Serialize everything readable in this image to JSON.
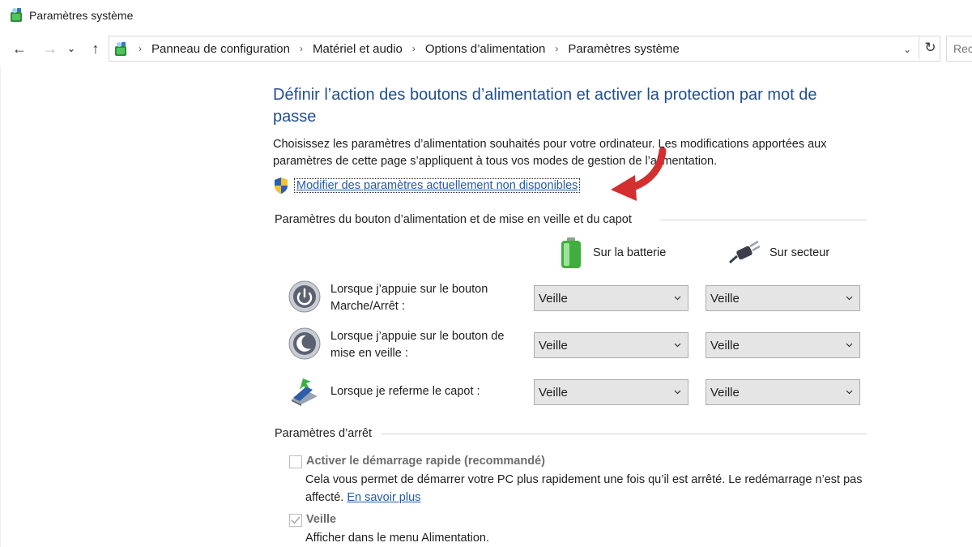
{
  "window": {
    "title": "Paramètres système"
  },
  "navigation": {
    "back_glyph": "←",
    "forward_glyph": "→",
    "recent_glyph": "⌄",
    "up_glyph": "↑",
    "breadcrumbs": [
      "Panneau de configuration",
      "Matériel et audio",
      "Options d’alimentation",
      "Paramètres système"
    ],
    "separator": "›",
    "dropdown_glyph": "⌄",
    "refresh_glyph": "↻",
    "search_placeholder": "Rec"
  },
  "main": {
    "heading": "Définir l’action des boutons d’alimentation et activer la protection par mot de passe",
    "description": "Choisissez les paramètres d’alimentation souhaités pour votre ordinateur. Les modifications apportées aux paramètres de cette page s’appliquent à tous vos modes de gestion de l’alimentation.",
    "modify_link": "Modifier des paramètres actuellement non disponibles"
  },
  "buttons_section": {
    "title": "Paramètres du bouton d’alimentation et de mise en veille et du capot",
    "columns": {
      "battery": "Sur la batterie",
      "plugged": "Sur secteur"
    },
    "rows": [
      {
        "icon": "power-button-icon",
        "label": "Lorsque j’appuie sur le bouton Marche/Arrêt :",
        "battery": "Veille",
        "plugged": "Veille"
      },
      {
        "icon": "sleep-button-icon",
        "label": "Lorsque j’appuie sur le bouton de mise en veille :",
        "battery": "Veille",
        "plugged": "Veille"
      },
      {
        "icon": "laptop-lid-icon",
        "label": "Lorsque je referme le capot :",
        "battery": "Veille",
        "plugged": "Veille"
      }
    ]
  },
  "shutdown_section": {
    "title": "Paramètres d’arrêt",
    "fast_startup": {
      "label": "Activer le démarrage rapide (recommandé)",
      "checked": false,
      "description": "Cela vous permet de démarrer votre PC plus rapidement une fois qu’il est arrêté. Le redémarrage n’est pas affecté.",
      "link": "En savoir plus"
    },
    "sleep": {
      "label": "Veille",
      "checked": true,
      "description": "Afficher dans le menu Alimentation."
    }
  },
  "colors": {
    "heading": "#1f4e93",
    "link": "#1f5bb0",
    "annotation_arrow": "#d32f2f",
    "disabled_text": "#6d6d6d"
  }
}
